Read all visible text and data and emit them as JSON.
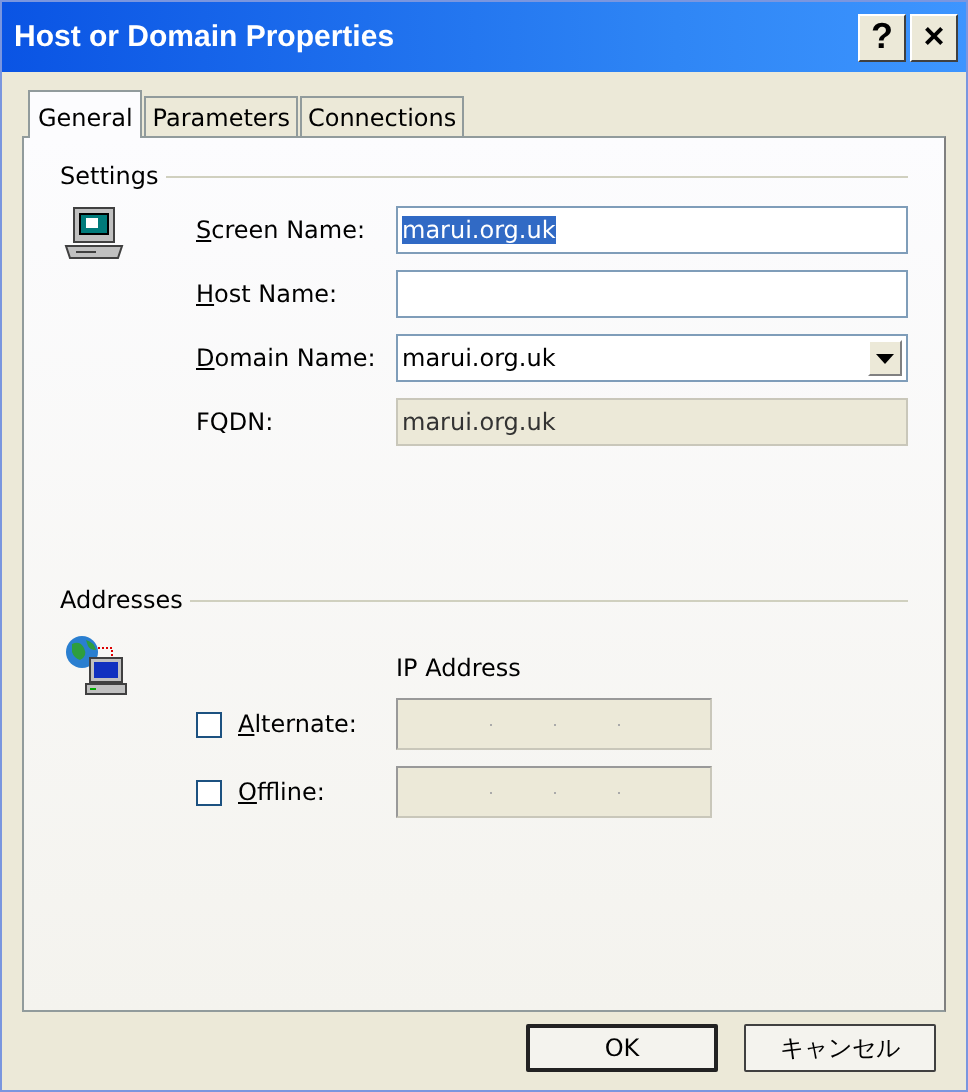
{
  "window": {
    "title": "Host or Domain Properties",
    "controls": [
      "?",
      "×"
    ]
  },
  "tabs": [
    {
      "label": "General",
      "selected": true
    },
    {
      "label": "Parameters",
      "selected": false
    },
    {
      "label": "Connections",
      "selected": false
    }
  ],
  "settings": {
    "heading": "Settings",
    "fields": [
      {
        "kind": "text",
        "label": "Screen Name:",
        "mnemonic": true,
        "value": "marui.org.uk",
        "highlighted": true,
        "disabled": false
      },
      {
        "kind": "text",
        "label": "Host Name:",
        "mnemonic": true,
        "disabled": false
      },
      {
        "kind": "combo",
        "label": "Domain Name:",
        "mnemonic": true,
        "value": "marui.org.uk",
        "disabled": false
      },
      {
        "kind": "text",
        "label": "FQDN:",
        "mnemonic": false,
        "value": "marui.org.uk",
        "disabled": true
      }
    ]
  },
  "addresses": {
    "heading": "Addresses",
    "column_header": "IP Address",
    "rows": [
      {
        "label": "Alternate:",
        "mnemonic": true,
        "checked": false
      },
      {
        "label": "Offline:",
        "mnemonic": true,
        "checked": false
      }
    ]
  },
  "buttons": [
    {
      "label": "OK",
      "default": true
    },
    {
      "label": "キャンセル",
      "default": false
    }
  ]
}
